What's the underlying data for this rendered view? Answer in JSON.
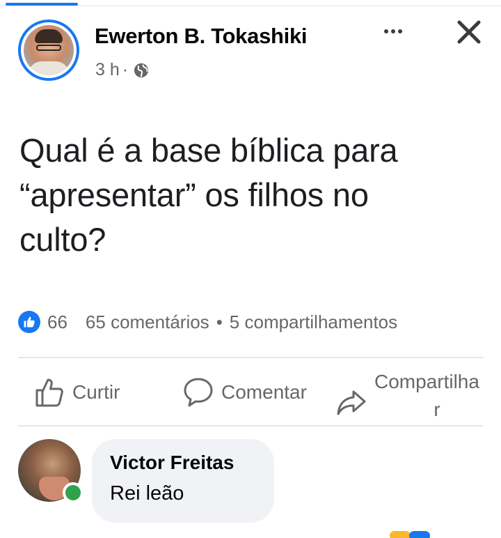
{
  "post": {
    "author": "Ewerton B. Tokashiki",
    "time": "3 h",
    "separator": "·",
    "privacy_icon": "globe-icon",
    "text_line1": "Qual é a base bíblica para",
    "text_line2": "“apresentar” os filhos no",
    "text_line3": "culto?"
  },
  "stats": {
    "reactions_count": "66",
    "comments": "65 comentários",
    "dot": "•",
    "shares": "5 compartilhamentos"
  },
  "actions": {
    "like": "Curtir",
    "comment": "Comentar",
    "share_line1": "Compartilha",
    "share_line2": "r"
  },
  "comment": {
    "author": "Victor Freitas",
    "text": "Rei leão"
  },
  "colors": {
    "brand": "#1877f2",
    "secondary_text": "#65676b",
    "online": "#31a24c",
    "bubble": "#f0f2f5"
  }
}
